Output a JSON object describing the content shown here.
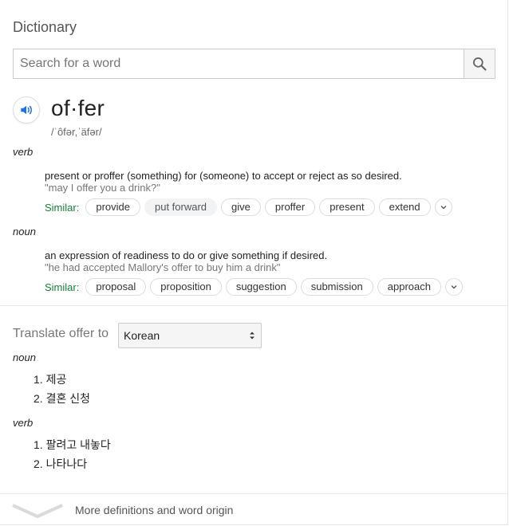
{
  "header": {
    "title": "Dictionary"
  },
  "search": {
    "placeholder": "Search for a word",
    "value": ""
  },
  "entry": {
    "word": "of·fer",
    "phonetic": "/ˈôfər,ˈäfər/",
    "senses": [
      {
        "pos": "verb",
        "definition": "present or proffer (something) for (someone) to accept or reject as so desired.",
        "example": "\"may I offer you a drink?\"",
        "similar_label": "Similar:",
        "similar": [
          "provide",
          "put forward",
          "give",
          "proffer",
          "present",
          "extend"
        ]
      },
      {
        "pos": "noun",
        "definition": "an expression of readiness to do or give something if desired.",
        "example": "\"he had accepted Mallory's offer to buy him a drink\"",
        "similar_label": "Similar:",
        "similar": [
          "proposal",
          "proposition",
          "suggestion",
          "submission",
          "approach"
        ]
      }
    ]
  },
  "translate": {
    "label": "Translate offer to",
    "language": "Korean",
    "groups": [
      {
        "pos": "noun",
        "items": [
          "1. 제공",
          "2. 결혼 신청"
        ]
      },
      {
        "pos": "verb",
        "items": [
          "1. 팔려고 내놓다",
          "2. 나타나다"
        ]
      }
    ]
  },
  "footer": {
    "more_label": "More definitions and word origin"
  },
  "colors": {
    "similar_label": "#188038",
    "speaker_icon": "#1a73e8"
  }
}
